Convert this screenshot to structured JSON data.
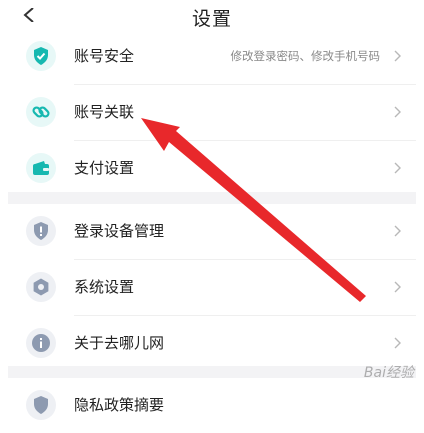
{
  "header": {
    "title": "设置"
  },
  "groups": [
    [
      {
        "label": "账号安全",
        "desc": "修改登录密码、修改手机号码",
        "icon": "shield-check-icon"
      },
      {
        "label": "账号关联",
        "desc": "",
        "icon": "link-icon"
      },
      {
        "label": "支付设置",
        "desc": "",
        "icon": "wallet-icon"
      }
    ],
    [
      {
        "label": "登录设备管理",
        "icon": "shield-exclamation-icon"
      },
      {
        "label": "系统设置",
        "icon": "gear-icon"
      },
      {
        "label": "关于去哪儿网",
        "icon": "info-icon"
      }
    ],
    [
      {
        "label": "隐私政策摘要",
        "icon": "shield-icon"
      }
    ]
  ],
  "watermark": "Bai经验",
  "colors": {
    "accent": "#16b8b0",
    "arrow": "#e8282b"
  }
}
